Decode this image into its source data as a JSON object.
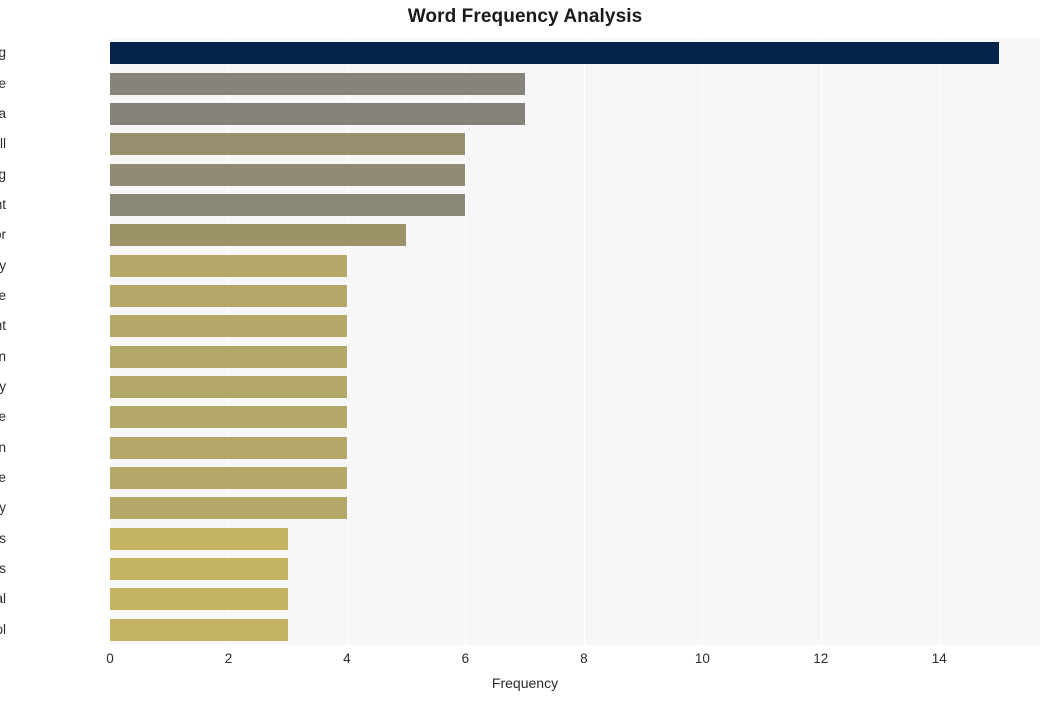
{
  "chart_data": {
    "type": "bar",
    "orientation": "horizontal",
    "title": "Word Frequency Analysis",
    "xlabel": "Frequency",
    "ylabel": "",
    "xlim": [
      0,
      15.7
    ],
    "ylim_categories": 20,
    "grid": true,
    "legend": null,
    "xticks": [
      "0",
      "2",
      "4",
      "6",
      "8",
      "10",
      "12",
      "14"
    ],
    "xtick_values": [
      0,
      2,
      4,
      6,
      8,
      10,
      12,
      14
    ],
    "categories": [
      "xinjiang",
      "force",
      "china",
      "call",
      "wang",
      "right",
      "labor",
      "century",
      "destabilize",
      "development",
      "human",
      "company",
      "people",
      "million",
      "enterprise",
      "seriously",
      "notorious",
      "laws",
      "global",
      "tool"
    ],
    "values": [
      15,
      7,
      7,
      6,
      6,
      6,
      5,
      4,
      4,
      4,
      4,
      4,
      4,
      4,
      4,
      4,
      3,
      3,
      3,
      3
    ],
    "bar_colors": [
      "#06244a",
      "#86837b",
      "#85827a",
      "#968f72",
      "#918b73",
      "#8a8777",
      "#9b9268",
      "#b3a868",
      "#b3a868",
      "#b3a868",
      "#b3a868",
      "#b3a868",
      "#b3a868",
      "#b3a868",
      "#b3a868",
      "#b3a868",
      "#c4b363",
      "#c4b363",
      "#c4b363",
      "#c4b363"
    ],
    "plot_background": "#f7f7f7",
    "gridline_color": "#ffffff",
    "title_color": "#1a1a1a",
    "tick_label_color": "#2b2b2b"
  }
}
